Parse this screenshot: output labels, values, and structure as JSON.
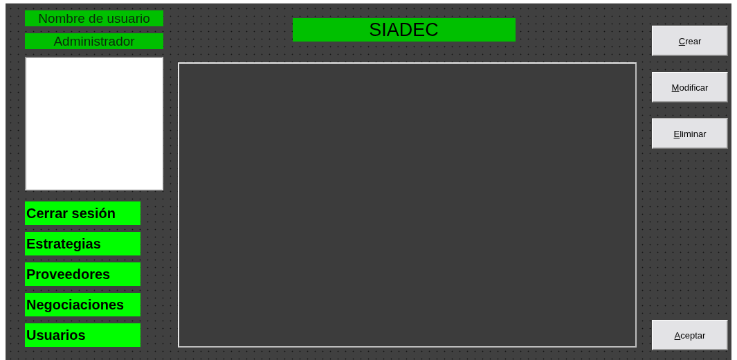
{
  "user_panel": {
    "username_label": "Nombre de usuario",
    "role": "Administrador"
  },
  "title": "SIADEC",
  "menu": [
    {
      "label": "Cerrar sesión"
    },
    {
      "label": "Estrategias"
    },
    {
      "label": "Proveedores"
    },
    {
      "label": "Negociaciones"
    },
    {
      "label": "Usuarios"
    }
  ],
  "actions": [
    "Crear",
    "Modificar",
    "Eliminar"
  ],
  "confirm_button": "Aceptar"
}
